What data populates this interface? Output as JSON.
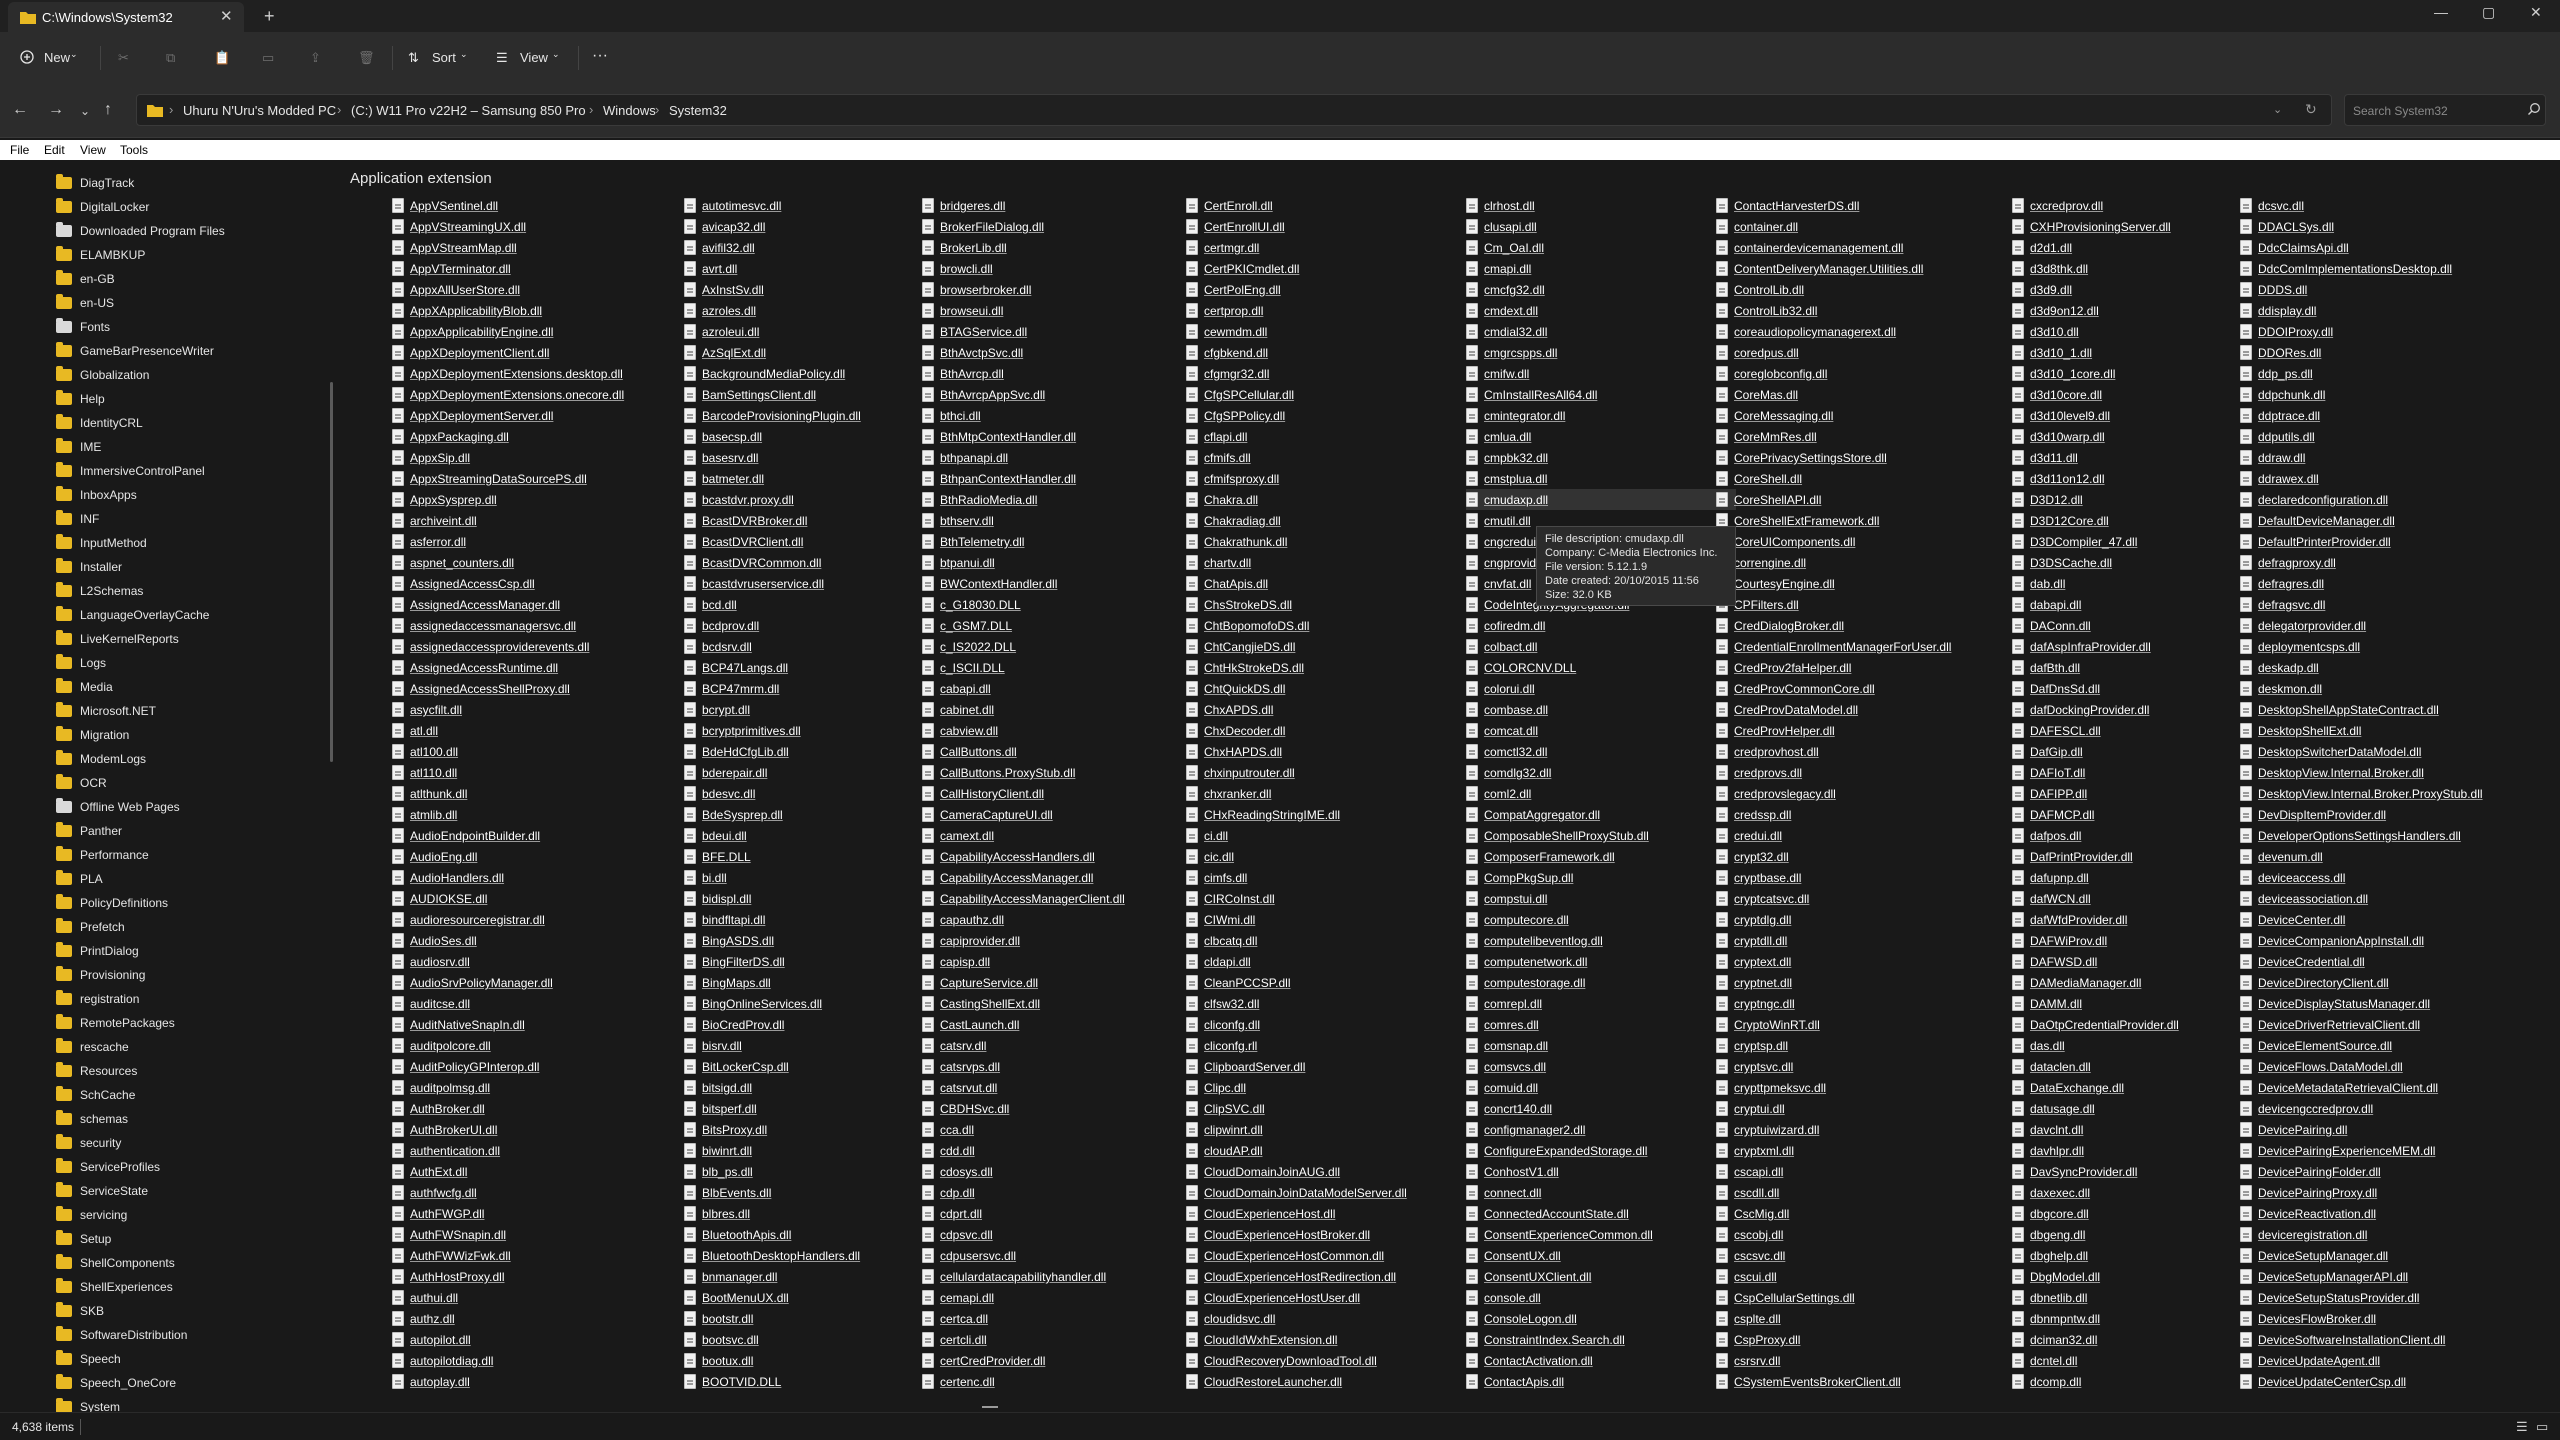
{
  "window": {
    "tab_title": "C:\\Windows\\System32",
    "controls": {
      "minimize": "—",
      "maximize": "▢",
      "close": "✕"
    }
  },
  "toolbar": {
    "new_label": "New",
    "sort_label": "Sort",
    "view_label": "View",
    "more_label": "···"
  },
  "address": {
    "crumbs": [
      "Uhuru N'Uru's Modded PC",
      "(C:) W11 Pro v22H2 – Samsung 850 Pro",
      "Windows",
      "System32"
    ],
    "search_placeholder": "Search System32"
  },
  "menu": {
    "file": "File",
    "edit": "Edit",
    "view": "View",
    "tools": "Tools"
  },
  "sidebar": {
    "items": [
      "DiagTrack",
      "DigitalLocker",
      "Downloaded Program Files",
      "ELAMBKUP",
      "en-GB",
      "en-US",
      "Fonts",
      "GameBarPresenceWriter",
      "Globalization",
      "Help",
      "IdentityCRL",
      "IME",
      "ImmersiveControlPanel",
      "InboxApps",
      "INF",
      "InputMethod",
      "Installer",
      "L2Schemas",
      "LanguageOverlayCache",
      "LiveKernelReports",
      "Logs",
      "Media",
      "Microsoft.NET",
      "Migration",
      "ModemLogs",
      "OCR",
      "Offline Web Pages",
      "Panther",
      "Performance",
      "PLA",
      "PolicyDefinitions",
      "Prefetch",
      "PrintDialog",
      "Provisioning",
      "registration",
      "RemotePackages",
      "rescache",
      "Resources",
      "SchCache",
      "schemas",
      "security",
      "ServiceProfiles",
      "ServiceState",
      "servicing",
      "Setup",
      "ShellComponents",
      "ShellExperiences",
      "SKB",
      "SoftwareDistribution",
      "Speech",
      "Speech_OneCore",
      "System"
    ]
  },
  "group_header": "Application extension",
  "columns": [
    [
      "AppVSentinel.dll",
      "AppVStreamingUX.dll",
      "AppVStreamMap.dll",
      "AppVTerminator.dll",
      "AppxAllUserStore.dll",
      "AppXApplicabilityBlob.dll",
      "AppxApplicabilityEngine.dll",
      "AppXDeploymentClient.dll",
      "AppXDeploymentExtensions.desktop.dll",
      "AppXDeploymentExtensions.onecore.dll",
      "AppXDeploymentServer.dll",
      "AppxPackaging.dll",
      "AppxSip.dll",
      "AppxStreamingDataSourcePS.dll",
      "AppxSysprep.dll",
      "archiveint.dll",
      "asferror.dll",
      "aspnet_counters.dll",
      "AssignedAccessCsp.dll",
      "AssignedAccessManager.dll",
      "assignedaccessmanagersvc.dll",
      "assignedaccessproviderevents.dll",
      "AssignedAccessRuntime.dll",
      "AssignedAccessShellProxy.dll",
      "asycfilt.dll",
      "atl.dll",
      "atl100.dll",
      "atl110.dll",
      "atlthunk.dll",
      "atmlib.dll",
      "AudioEndpointBuilder.dll",
      "AudioEng.dll",
      "AudioHandlers.dll",
      "AUDIOKSE.dll",
      "audioresourceregistrar.dll",
      "AudioSes.dll",
      "audiosrv.dll",
      "AudioSrvPolicyManager.dll",
      "auditcse.dll",
      "AuditNativeSnapIn.dll",
      "auditpolcore.dll",
      "AuditPolicyGPInterop.dll",
      "auditpolmsg.dll",
      "AuthBroker.dll",
      "AuthBrokerUI.dll",
      "authentication.dll",
      "AuthExt.dll",
      "authfwcfg.dll",
      "AuthFWGP.dll",
      "AuthFWSnapin.dll",
      "AuthFWWizFwk.dll",
      "AuthHostProxy.dll",
      "authui.dll",
      "authz.dll",
      "autopilot.dll",
      "autopilotdiag.dll",
      "autoplay.dll"
    ],
    [
      "autotimesvc.dll",
      "avicap32.dll",
      "avifil32.dll",
      "avrt.dll",
      "AxInstSv.dll",
      "azroles.dll",
      "azroleui.dll",
      "AzSqlExt.dll",
      "BackgroundMediaPolicy.dll",
      "BamSettingsClient.dll",
      "BarcodeProvisioningPlugin.dll",
      "basecsp.dll",
      "basesrv.dll",
      "batmeter.dll",
      "bcastdvr.proxy.dll",
      "BcastDVRBroker.dll",
      "BcastDVRClient.dll",
      "BcastDVRCommon.dll",
      "bcastdvruserservice.dll",
      "bcd.dll",
      "bcdprov.dll",
      "bcdsrv.dll",
      "BCP47Langs.dll",
      "BCP47mrm.dll",
      "bcrypt.dll",
      "bcryptprimitives.dll",
      "BdeHdCfgLib.dll",
      "bderepair.dll",
      "bdesvc.dll",
      "BdeSysprep.dll",
      "bdeui.dll",
      "BFE.DLL",
      "bi.dll",
      "bidispl.dll",
      "bindfltapi.dll",
      "BingASDS.dll",
      "BingFilterDS.dll",
      "BingMaps.dll",
      "BingOnlineServices.dll",
      "BioCredProv.dll",
      "bisrv.dll",
      "BitLockerCsp.dll",
      "bitsigd.dll",
      "bitsperf.dll",
      "BitsProxy.dll",
      "biwinrt.dll",
      "blb_ps.dll",
      "BlbEvents.dll",
      "blbres.dll",
      "BluetoothApis.dll",
      "BluetoothDesktopHandlers.dll",
      "bnmanager.dll",
      "BootMenuUX.dll",
      "bootstr.dll",
      "bootsvc.dll",
      "bootux.dll",
      "BOOTVID.DLL"
    ],
    [
      "bridgeres.dll",
      "BrokerFileDialog.dll",
      "BrokerLib.dll",
      "browcli.dll",
      "browserbroker.dll",
      "browseui.dll",
      "BTAGService.dll",
      "BthAvctpSvc.dll",
      "BthAvrcp.dll",
      "BthAvrcpAppSvc.dll",
      "bthci.dll",
      "BthMtpContextHandler.dll",
      "bthpanapi.dll",
      "BthpanContextHandler.dll",
      "BthRadioMedia.dll",
      "bthserv.dll",
      "BthTelemetry.dll",
      "btpanui.dll",
      "BWContextHandler.dll",
      "c_G18030.DLL",
      "c_GSM7.DLL",
      "c_IS2022.DLL",
      "c_ISCII.DLL",
      "cabapi.dll",
      "cabinet.dll",
      "cabview.dll",
      "CallButtons.dll",
      "CallButtons.ProxyStub.dll",
      "CallHistoryClient.dll",
      "CameraCaptureUI.dll",
      "camext.dll",
      "CapabilityAccessHandlers.dll",
      "CapabilityAccessManager.dll",
      "CapabilityAccessManagerClient.dll",
      "capauthz.dll",
      "capiprovider.dll",
      "capisp.dll",
      "CaptureService.dll",
      "CastingShellExt.dll",
      "CastLaunch.dll",
      "catsrv.dll",
      "catsrvps.dll",
      "catsrvut.dll",
      "CBDHSvc.dll",
      "cca.dll",
      "cdd.dll",
      "cdosys.dll",
      "cdp.dll",
      "cdprt.dll",
      "cdpsvc.dll",
      "cdpusersvc.dll",
      "cellulardatacapabilityhandler.dll",
      "cemapi.dll",
      "certca.dll",
      "certcli.dll",
      "certCredProvider.dll",
      "certenc.dll"
    ],
    [
      "CertEnroll.dll",
      "CertEnrollUI.dll",
      "certmgr.dll",
      "CertPKICmdlet.dll",
      "CertPolEng.dll",
      "certprop.dll",
      "cewmdm.dll",
      "cfgbkend.dll",
      "cfgmgr32.dll",
      "CfgSPCellular.dll",
      "CfgSPPolicy.dll",
      "cflapi.dll",
      "cfmifs.dll",
      "cfmifsproxy.dll",
      "Chakra.dll",
      "Chakradiag.dll",
      "Chakrathunk.dll",
      "chartv.dll",
      "ChatApis.dll",
      "ChsStrokeDS.dll",
      "ChtBopomofoDS.dll",
      "ChtCangjieDS.dll",
      "ChtHkStrokeDS.dll",
      "ChtQuickDS.dll",
      "ChxAPDS.dll",
      "ChxDecoder.dll",
      "ChxHAPDS.dll",
      "chxinputrouter.dll",
      "chxranker.dll",
      "CHxReadingStringIME.dll",
      "ci.dll",
      "cic.dll",
      "cimfs.dll",
      "CIRCoInst.dll",
      "CIWmi.dll",
      "clbcatq.dll",
      "cldapi.dll",
      "CleanPCCSP.dll",
      "clfsw32.dll",
      "cliconfg.dll",
      "cliconfg.rll",
      "ClipboardServer.dll",
      "Clipc.dll",
      "ClipSVC.dll",
      "clipwinrt.dll",
      "cloudAP.dll",
      "CloudDomainJoinAUG.dll",
      "CloudDomainJoinDataModelServer.dll",
      "CloudExperienceHost.dll",
      "CloudExperienceHostBroker.dll",
      "CloudExperienceHostCommon.dll",
      "CloudExperienceHostRedirection.dll",
      "CloudExperienceHostUser.dll",
      "cloudidsvc.dll",
      "CloudIdWxhExtension.dll",
      "CloudRecoveryDownloadTool.dll",
      "CloudRestoreLauncher.dll"
    ],
    [
      "clrhost.dll",
      "clusapi.dll",
      "Cm_OaI.dll",
      "cmapi.dll",
      "cmcfg32.dll",
      "cmdext.dll",
      "cmdial32.dll",
      "cmgrcspps.dll",
      "cmifw.dll",
      "CmInstallResAll64.dll",
      "cmintegrator.dll",
      "cmlua.dll",
      "cmpbk32.dll",
      "cmstplua.dll",
      "cmudaxp.dll",
      "cmutil.dll",
      "cngcredui.dll",
      "cngprovider.dll",
      "cnvfat.dll",
      "CodeIntegrityAggregator.dll",
      "cofiredm.dll",
      "colbact.dll",
      "COLORCNV.DLL",
      "colorui.dll",
      "combase.dll",
      "comcat.dll",
      "comctl32.dll",
      "comdlg32.dll",
      "coml2.dll",
      "CompatAggregator.dll",
      "ComposableShellProxyStub.dll",
      "ComposerFramework.dll",
      "CompPkgSup.dll",
      "compstui.dll",
      "computecore.dll",
      "computelibeventlog.dll",
      "computenetwork.dll",
      "computestorage.dll",
      "comrepl.dll",
      "comres.dll",
      "comsnap.dll",
      "comsvcs.dll",
      "comuid.dll",
      "concrt140.dll",
      "configmanager2.dll",
      "ConfigureExpandedStorage.dll",
      "ConhostV1.dll",
      "connect.dll",
      "ConnectedAccountState.dll",
      "ConsentExperienceCommon.dll",
      "ConsentUX.dll",
      "ConsentUXClient.dll",
      "console.dll",
      "ConsoleLogon.dll",
      "ConstraintIndex.Search.dll",
      "ContactActivation.dll",
      "ContactApis.dll"
    ],
    [
      "ContactHarvesterDS.dll",
      "container.dll",
      "containerdevicemanagement.dll",
      "ContentDeliveryManager.Utilities.dll",
      "ControlLib.dll",
      "ControlLib32.dll",
      "coreaudiopolicymanagerext.dll",
      "coredpus.dll",
      "coreglobconfig.dll",
      "CoreMas.dll",
      "CoreMessaging.dll",
      "CoreMmRes.dll",
      "CorePrivacySettingsStore.dll",
      "CoreShell.dll",
      "CoreShellAPI.dll",
      "CoreShellExtFramework.dll",
      "CoreUIComponents.dll",
      "correngine.dll",
      "CourtesyEngine.dll",
      "CPFilters.dll",
      "CredDialogBroker.dll",
      "CredentialEnrollmentManagerForUser.dll",
      "CredProv2faHelper.dll",
      "CredProvCommonCore.dll",
      "CredProvDataModel.dll",
      "CredProvHelper.dll",
      "credprovhost.dll",
      "credprovs.dll",
      "credprovslegacy.dll",
      "credssp.dll",
      "credui.dll",
      "crypt32.dll",
      "cryptbase.dll",
      "cryptcatsvc.dll",
      "cryptdlg.dll",
      "cryptdll.dll",
      "cryptext.dll",
      "cryptnet.dll",
      "cryptngc.dll",
      "CryptoWinRT.dll",
      "cryptsp.dll",
      "cryptsvc.dll",
      "crypttpmeksvc.dll",
      "cryptui.dll",
      "cryptuiwizard.dll",
      "cryptxml.dll",
      "cscapi.dll",
      "cscdll.dll",
      "CscMig.dll",
      "cscobj.dll",
      "cscsvc.dll",
      "cscui.dll",
      "CspCellularSettings.dll",
      "csplte.dll",
      "CspProxy.dll",
      "csrsrv.dll",
      "CSystemEventsBrokerClient.dll"
    ],
    [
      "cxcredprov.dll",
      "CXHProvisioningServer.dll",
      "d2d1.dll",
      "d3d8thk.dll",
      "d3d9.dll",
      "d3d9on12.dll",
      "d3d10.dll",
      "d3d10_1.dll",
      "d3d10_1core.dll",
      "d3d10core.dll",
      "d3d10level9.dll",
      "d3d10warp.dll",
      "d3d11.dll",
      "d3d11on12.dll",
      "D3D12.dll",
      "D3D12Core.dll",
      "D3DCompiler_47.dll",
      "D3DSCache.dll",
      "dab.dll",
      "dabapi.dll",
      "DAConn.dll",
      "dafAspInfraProvider.dll",
      "dafBth.dll",
      "DafDnsSd.dll",
      "dafDockingProvider.dll",
      "DAFESCL.dll",
      "DafGip.dll",
      "DAFIoT.dll",
      "DAFIPP.dll",
      "DAFMCP.dll",
      "dafpos.dll",
      "DafPrintProvider.dll",
      "dafupnp.dll",
      "dafWCN.dll",
      "dafWfdProvider.dll",
      "DAFWiProv.dll",
      "DAFWSD.dll",
      "DAMediaManager.dll",
      "DAMM.dll",
      "DaOtpCredentialProvider.dll",
      "das.dll",
      "dataclen.dll",
      "DataExchange.dll",
      "datusage.dll",
      "davclnt.dll",
      "davhlpr.dll",
      "DavSyncProvider.dll",
      "daxexec.dll",
      "dbgcore.dll",
      "dbgeng.dll",
      "dbghelp.dll",
      "DbgModel.dll",
      "dbnetlib.dll",
      "dbnmpntw.dll",
      "dciman32.dll",
      "dcntel.dll",
      "dcomp.dll"
    ],
    [
      "dcsvc.dll",
      "DDACLSys.dll",
      "DdcClaimsApi.dll",
      "DdcComImplementationsDesktop.dll",
      "DDDS.dll",
      "ddisplay.dll",
      "DDOIProxy.dll",
      "DDORes.dll",
      "ddp_ps.dll",
      "ddpchunk.dll",
      "ddptrace.dll",
      "ddputils.dll",
      "ddraw.dll",
      "ddrawex.dll",
      "declaredconfiguration.dll",
      "DefaultDeviceManager.dll",
      "DefaultPrinterProvider.dll",
      "defragproxy.dll",
      "defragres.dll",
      "defragsvc.dll",
      "delegatorprovider.dll",
      "deploymentcsps.dll",
      "deskadp.dll",
      "deskmon.dll",
      "DesktopShellAppStateContract.dll",
      "DesktopShellExt.dll",
      "DesktopSwitcherDataModel.dll",
      "DesktopView.Internal.Broker.dll",
      "DesktopView.Internal.Broker.ProxyStub.dll",
      "DevDispItemProvider.dll",
      "DeveloperOptionsSettingsHandlers.dll",
      "devenum.dll",
      "deviceaccess.dll",
      "deviceassociation.dll",
      "DeviceCenter.dll",
      "DeviceCompanionAppInstall.dll",
      "DeviceCredential.dll",
      "DeviceDirectoryClient.dll",
      "DeviceDisplayStatusManager.dll",
      "DeviceDriverRetrievalClient.dll",
      "DeviceElementSource.dll",
      "DeviceFlows.DataModel.dll",
      "DeviceMetadataRetrievalClient.dll",
      "devicengccredprov.dll",
      "DevicePairing.dll",
      "DevicePairingExperienceMEM.dll",
      "DevicePairingFolder.dll",
      "DevicePairingProxy.dll",
      "DeviceReactivation.dll",
      "deviceregistration.dll",
      "DeviceSetupManager.dll",
      "DeviceSetupManagerAPI.dll",
      "DeviceSetupStatusProvider.dll",
      "DevicesFlowBroker.dll",
      "DeviceSoftwareInstallationClient.dll",
      "DeviceUpdateAgent.dll",
      "DeviceUpdateCenterCsp.dll"
    ]
  ],
  "tooltip": {
    "lines": [
      "File description: cmudaxp.dll",
      "Company: C-Media Electronics Inc.",
      "File version: 5.12.1.9",
      "Date created: 20/10/2015 11:56",
      "Size: 32.0 KB"
    ]
  },
  "status": {
    "items_count": "4,638 items"
  }
}
